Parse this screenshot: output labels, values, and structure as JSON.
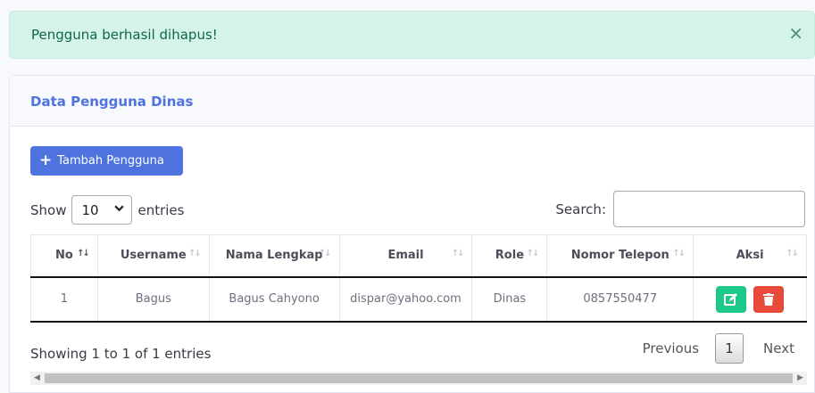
{
  "alert": {
    "message": "Pengguna berhasil dihapus!",
    "close": "×"
  },
  "card": {
    "title": "Data Pengguna Dinas"
  },
  "add_button": {
    "label": "Tambah Pengguna"
  },
  "length": {
    "show": "Show",
    "value": "10",
    "entries": "entries"
  },
  "search": {
    "label": "Search:",
    "value": ""
  },
  "table": {
    "headers": [
      "No",
      "Username",
      "Nama Lengkap",
      "Email",
      "Role",
      "Nomor Telepon",
      "Aksi"
    ],
    "rows": [
      {
        "no": "1",
        "username": "Bagus",
        "nama_lengkap": "Bagus Cahyono",
        "email": "dispar@yahoo.com",
        "role": "Dinas",
        "telepon": "0857550477"
      }
    ]
  },
  "info": "Showing 1 to 1 of 1 entries",
  "pagination": {
    "previous": "Previous",
    "current": "1",
    "next": "Next"
  },
  "colors": {
    "primary": "#4e73df",
    "success": "#1cc88a",
    "danger": "#e74a3b",
    "alert_bg": "#d5f3e9"
  },
  "icons": {
    "add": "plus-icon",
    "edit": "edit-icon",
    "delete": "trash-icon",
    "close": "close-icon"
  }
}
